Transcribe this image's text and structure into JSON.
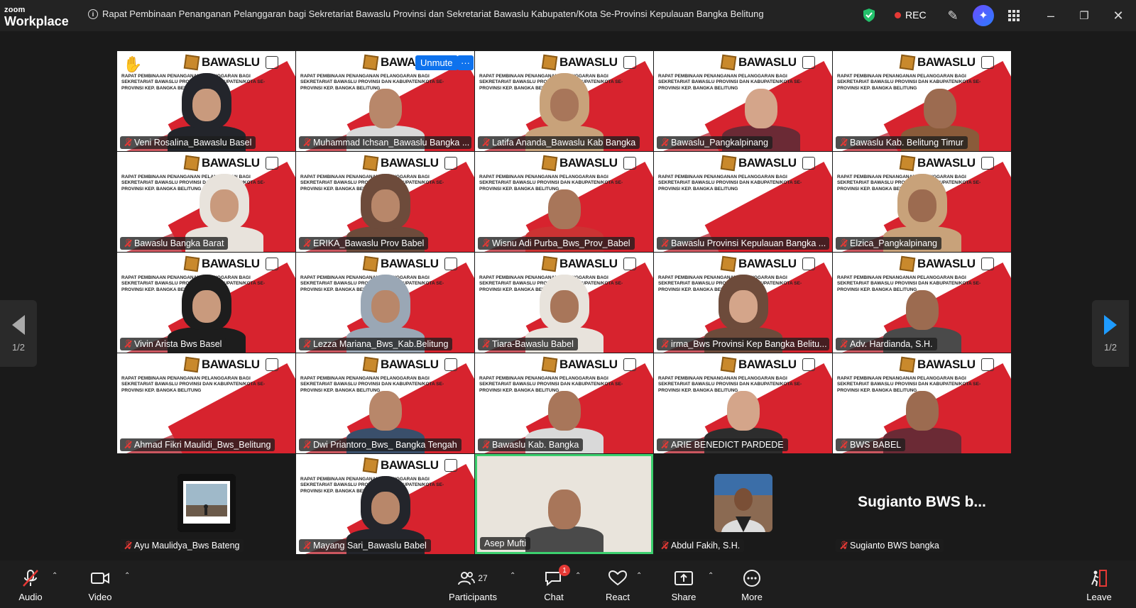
{
  "app": {
    "brand_small": "zoom",
    "brand_big": "Workplace"
  },
  "meeting": {
    "title": "Rapat Pembinaan Penanganan Pelanggaran bagi Sekretariat Bawaslu Provinsi dan Sekretariat Bawaslu Kabupaten/Kota Se-Provinsi Kepulauan Bangka Belitung",
    "rec_label": "REC"
  },
  "banner": {
    "brand": "BAWASLU",
    "text": "RAPAT PEMBINAAN PENANGANAN PELANGGARAN BAGI SEKRETARIAT BAWASLU PROVINSI DAN KABUPATEN/KOTA SE-PROVINSI KEP. BANGKA BELITUNG"
  },
  "tile_controls": {
    "unmute_label": "Unmute",
    "more_label": "···"
  },
  "participants_grid": [
    "Veni Rosalina_Bawaslu Basel",
    "Muhammad Ichsan_Bawaslu Bangka ...",
    "Latifa Ananda_Bawaslu Kab Bangka",
    "Bawaslu_Pangkalpinang",
    "Bawaslu Kab. Belitung Timur",
    "Bawaslu Bangka Barat",
    "ERIKA_Bawaslu Prov Babel",
    "Wisnu Adi Purba_Bws_Prov_Babel",
    "Bawaslu Provinsi Kepulauan Bangka ...",
    "Elzica_Pangkalpinang",
    "Vivin Arista Bws Basel",
    "Lezza Mariana_Bws_Kab.Belitung",
    "Tiara-Bawaslu Babel",
    "irma_Bws Provinsi Kep Bangka Belitu...",
    "Adv. Hardianda, S.H.",
    "Ahmad Fikri Maulidi_Bws_Belitung",
    "Dwi Priantoro_Bws_ Bangka Tengah",
    "Bawaslu Kab. Bangka",
    "ARIE BENEDICT PARDEDE",
    "BWS BABEL",
    "Ayu Maulidya_Bws Bateng",
    "Mayang Sari_Bawaslu Babel",
    "Asep Mufti",
    "Abdul Fakih, S.H.",
    "Sugianto BWS bangka"
  ],
  "big_name": "Sugianto BWS b...",
  "pager": {
    "left_label": "1/2",
    "right_label": "1/2"
  },
  "toolbar": {
    "audio": "Audio",
    "video": "Video",
    "participants": "Participants",
    "participants_count": "27",
    "chat": "Chat",
    "chat_badge": "1",
    "react": "React",
    "share": "Share",
    "more": "More",
    "leave": "Leave"
  },
  "colors": {
    "accent": "#0e72ed",
    "active_speaker": "#3ccf6e",
    "bawaslu_red": "#d7232e",
    "rec": "#e53935"
  }
}
